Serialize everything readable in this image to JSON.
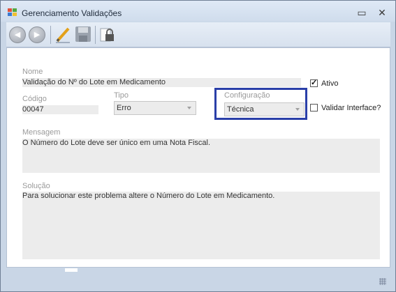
{
  "window": {
    "title": "Gerenciamento Validações",
    "minimize_glyph": "▭",
    "close_glyph": "✕"
  },
  "toolbar": {
    "back_icon": "arrow-left-icon",
    "forward_icon": "arrow-right-icon",
    "edit_icon": "pencil-icon",
    "save_icon": "floppy-disk-icon",
    "lock_icon": "lock-icon"
  },
  "form": {
    "nome": {
      "label": "Nome",
      "value": "Validação do Nº do Lote em Medicamento"
    },
    "ativo": {
      "label": "Ativo",
      "checked": true
    },
    "codigo": {
      "label": "Código",
      "value": "00047"
    },
    "tipo": {
      "label": "Tipo",
      "value": "Erro"
    },
    "configuracao": {
      "label": "Configuração",
      "value": "Técnica"
    },
    "validar_interface": {
      "label": "Validar Interface?",
      "checked": false
    },
    "mensagem": {
      "label": "Mensagem",
      "value": "O Número do Lote deve ser único em uma Nota Fiscal."
    },
    "solucao": {
      "label": "Solução",
      "value": "Para solucionar este problema altere o Número do Lote em Medicamento."
    }
  },
  "colors": {
    "highlight_border": "#2a3fa8",
    "window_frame": "#c9d6e6"
  }
}
